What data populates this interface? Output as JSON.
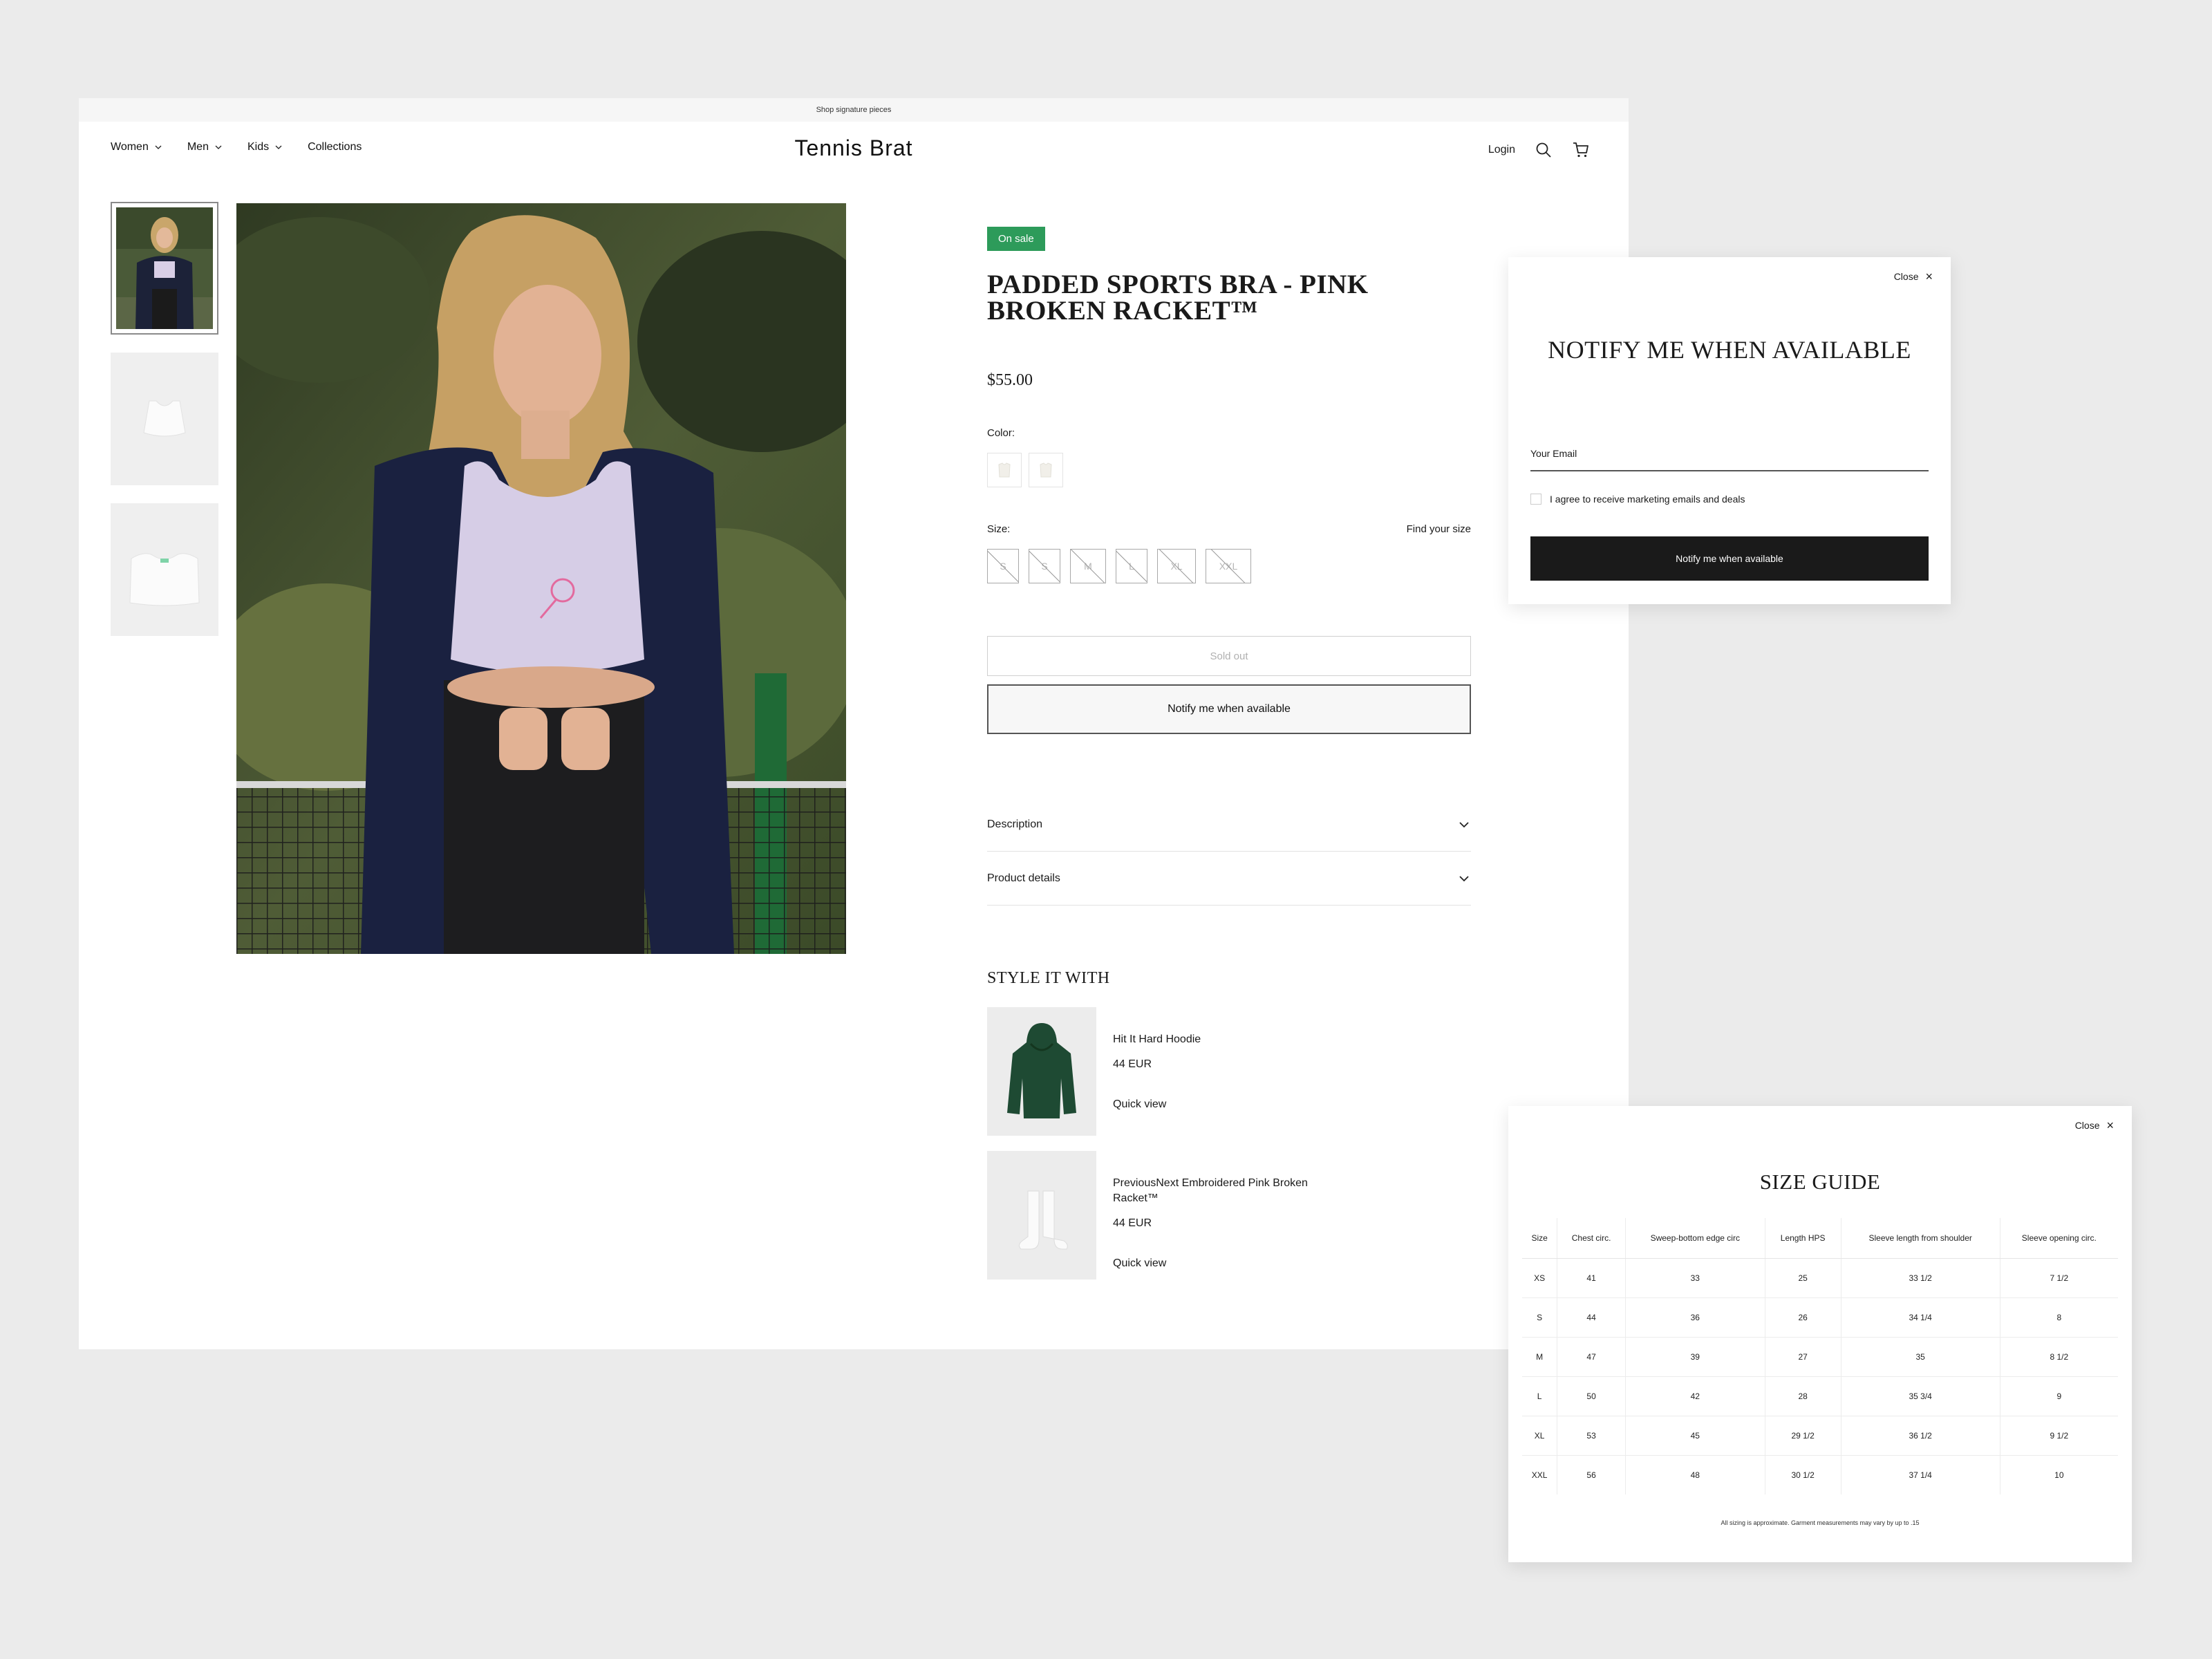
{
  "announcement": "Shop signature pieces",
  "header": {
    "nav": [
      {
        "label": "Women",
        "has_dropdown": true
      },
      {
        "label": "Men",
        "has_dropdown": true
      },
      {
        "label": "Kids",
        "has_dropdown": true
      },
      {
        "label": "Collections",
        "has_dropdown": false
      }
    ],
    "logo": "Tennis Brat",
    "login": "Login"
  },
  "product": {
    "badge": "On sale",
    "badge_color": "#2d9b5a",
    "title": "PADDED SPORTS BRA - PINK BROKEN RACKET™",
    "price": "$55.00",
    "color_label": "Color:",
    "size_label": "Size:",
    "find_size": "Find your size",
    "sizes": [
      "S",
      "S",
      "M",
      "L",
      "XL",
      "XXL"
    ],
    "sold_out": "Sold out",
    "notify": "Notify me when available",
    "accordions": [
      "Description",
      "Product details"
    ]
  },
  "style_it_with": {
    "heading": "STYLE IT WITH",
    "items": [
      {
        "name": "Hit It Hard Hoodie",
        "price": "44 EUR",
        "quick_view": "Quick view"
      },
      {
        "name": "PreviousNext Embroidered Pink Broken Racket™",
        "price": "44 EUR",
        "quick_view": "Quick view"
      }
    ]
  },
  "notify_modal": {
    "close": "Close",
    "title": "NOTIFY ME WHEN AVAILABLE",
    "email_label": "Your Email",
    "consent": "I agree to receive marketing emails and deals",
    "button": "Notify me when available"
  },
  "size_guide": {
    "close": "Close",
    "title": "SIZE GUIDE",
    "columns": [
      "Size",
      "Chest circ.",
      "Sweep-bottom edge circ",
      "Length HPS",
      "Sleeve length from shoulder",
      "Sleeve opening circ."
    ],
    "rows": [
      [
        "XS",
        "41",
        "33",
        "25",
        "33 1/2",
        "7 1/2"
      ],
      [
        "S",
        "44",
        "36",
        "26",
        "34 1/4",
        "8"
      ],
      [
        "M",
        "47",
        "39",
        "27",
        "35",
        "8 1/2"
      ],
      [
        "L",
        "50",
        "42",
        "28",
        "35 3/4",
        "9"
      ],
      [
        "XL",
        "53",
        "45",
        "29 1/2",
        "36 1/2",
        "9 1/2"
      ],
      [
        "XXL",
        "56",
        "48",
        "30 1/2",
        "37 1/4",
        "10"
      ]
    ],
    "note": "All sizing is approximate. Garment measurements may vary by up to .15"
  }
}
